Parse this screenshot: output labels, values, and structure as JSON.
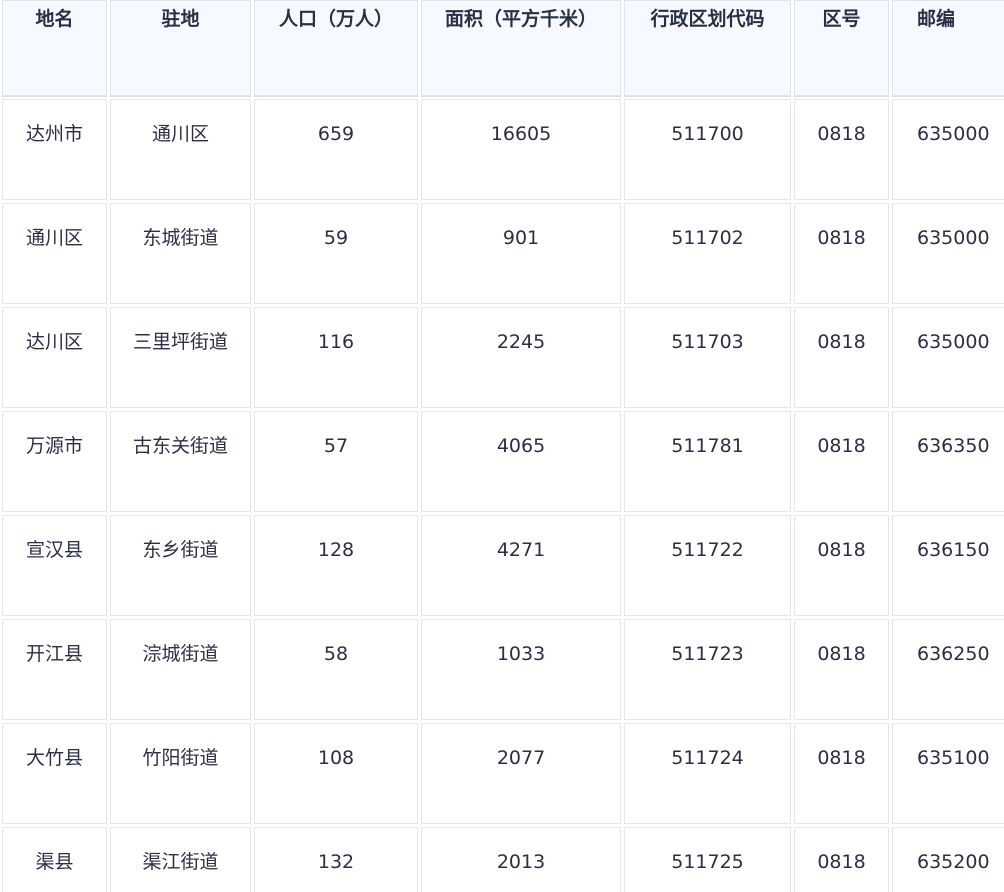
{
  "table": {
    "headers": [
      "地名",
      "驻地",
      "人口（万人）",
      "面积（平方千米）",
      "行政区划代码",
      "区号",
      "邮编"
    ],
    "rows": [
      [
        "达州市",
        "通川区",
        "659",
        "16605",
        "511700",
        "0818",
        "635000"
      ],
      [
        "通川区",
        "东城街道",
        "59",
        "901",
        "511702",
        "0818",
        "635000"
      ],
      [
        "达川区",
        "三里坪街道",
        "116",
        "2245",
        "511703",
        "0818",
        "635000"
      ],
      [
        "万源市",
        "古东关街道",
        "57",
        "4065",
        "511781",
        "0818",
        "636350"
      ],
      [
        "宣汉县",
        "东乡街道",
        "128",
        "4271",
        "511722",
        "0818",
        "636150"
      ],
      [
        "开江县",
        "淙城街道",
        "58",
        "1033",
        "511723",
        "0818",
        "636250"
      ],
      [
        "大竹县",
        "竹阳街道",
        "108",
        "2077",
        "511724",
        "0818",
        "635100"
      ],
      [
        "渠县",
        "渠江街道",
        "132",
        "2013",
        "511725",
        "0818",
        "635200"
      ]
    ]
  }
}
